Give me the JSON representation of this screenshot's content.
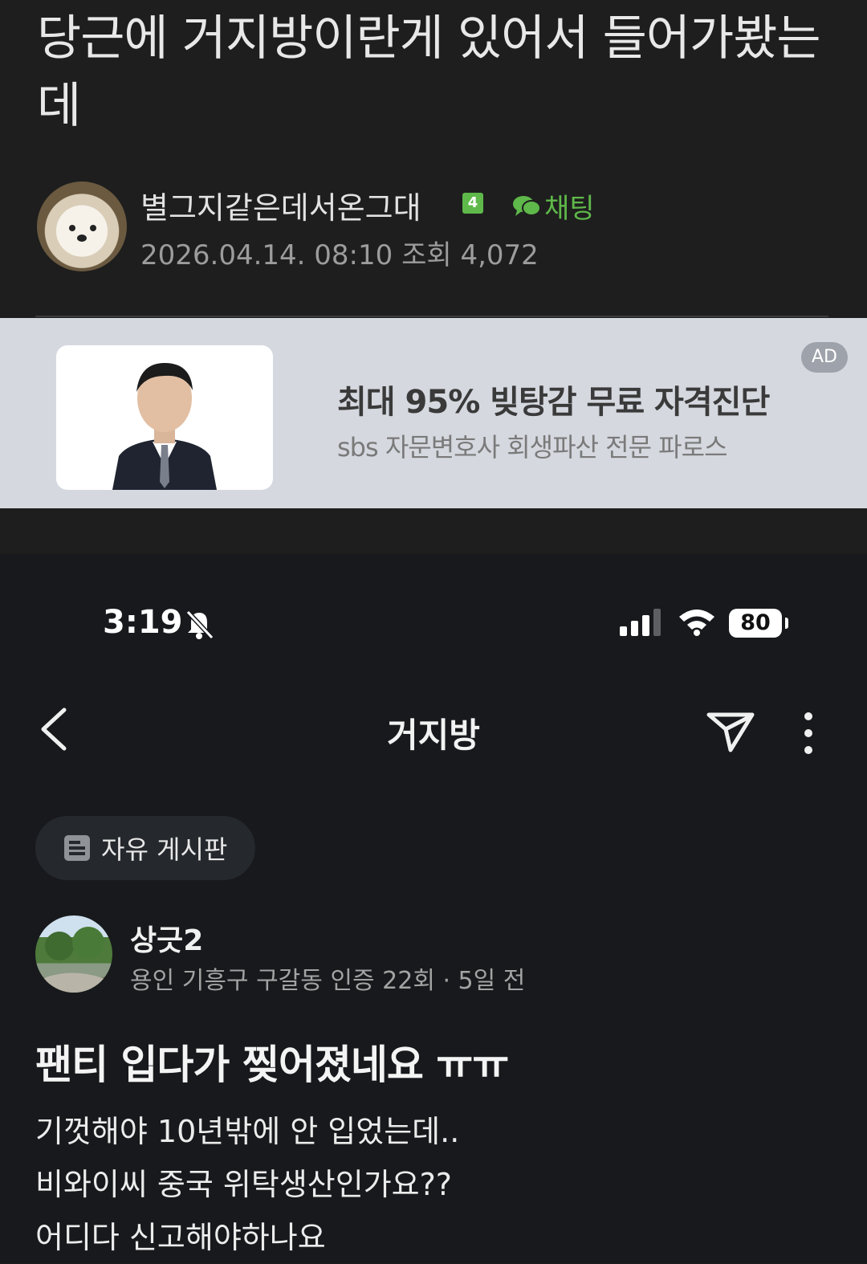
{
  "post": {
    "title": "당근에 거지방이란게 있어서 들어가봤는데",
    "author": "별그지같은데서온그대",
    "level": "4",
    "chat_label": "채팅",
    "meta": "2026.04.14. 08:10 조회 4,072"
  },
  "ad": {
    "headline": "최대 95% 빚탕감 무료 자격진단",
    "sub": "sbs 자문변호사 회생파산 전문 파로스",
    "badge": "AD"
  },
  "phone": {
    "status": {
      "time": "3:19",
      "battery": "80"
    },
    "header": {
      "title": "거지방"
    },
    "board_chip": "자유 게시판",
    "author": {
      "name": "상긋2",
      "meta": "용인 기흥구 구갈동 인증 22회 · 5일 전"
    },
    "article": {
      "title": "팬티 입다가 찢어졌네요 ㅠㅠ",
      "lines": [
        "기껏해야 10년밖에 안 입었는데..",
        "비와이씨 중국 위탁생산인가요??",
        "어디다 신고해야하나요"
      ]
    }
  }
}
